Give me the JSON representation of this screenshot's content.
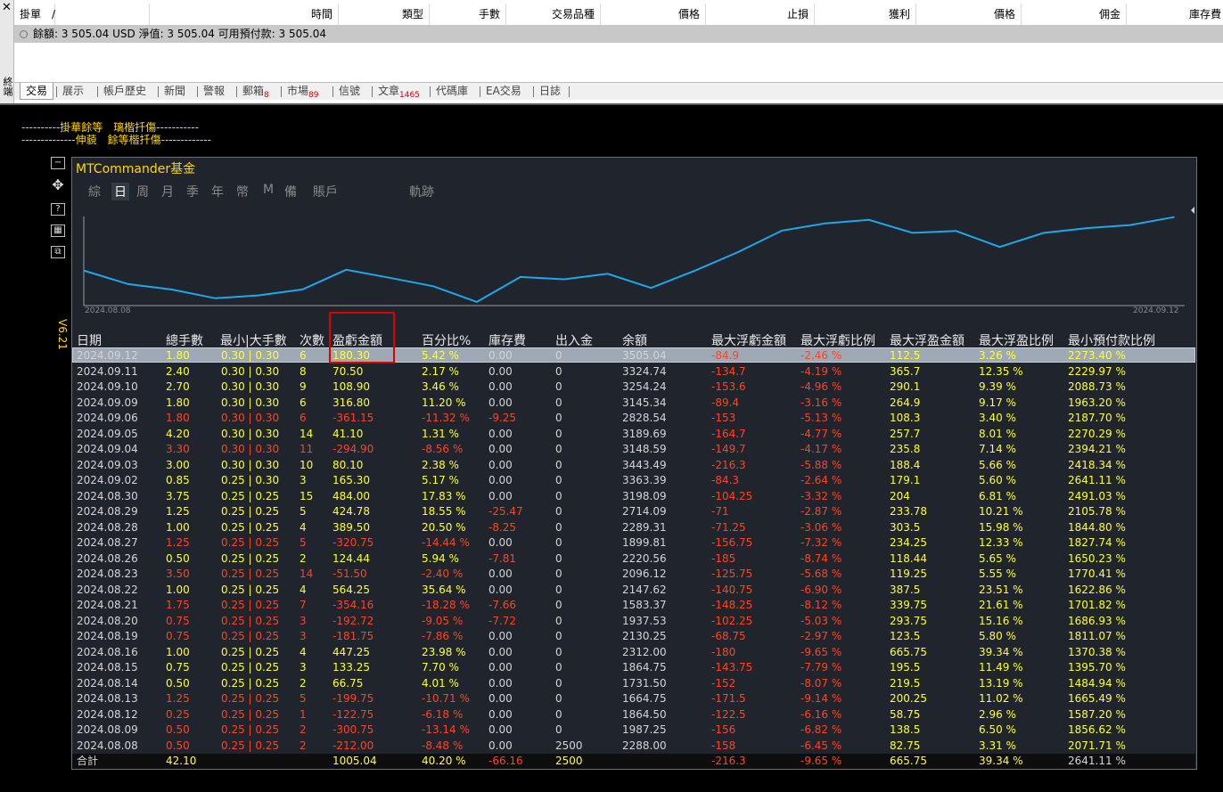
{
  "window": {
    "close_glyph": "✕",
    "side_label": "終端"
  },
  "header": {
    "columns": [
      "掛單",
      "/",
      "時間",
      "類型",
      "手數",
      "交易品種",
      "價格",
      "止損",
      "獲利",
      "價格",
      "佣金",
      "庫存費"
    ]
  },
  "balance_text": "餘額: 3 505.04 USD  淨值: 3 505.04  可用預付款: 3 505.04",
  "tabs": [
    {
      "label": "交易",
      "badge": ""
    },
    {
      "label": "展示",
      "badge": ""
    },
    {
      "label": "帳戶歷史",
      "badge": ""
    },
    {
      "label": "新聞",
      "badge": ""
    },
    {
      "label": "警報",
      "badge": ""
    },
    {
      "label": "郵箱",
      "badge": "8"
    },
    {
      "label": "市場",
      "badge": "89"
    },
    {
      "label": "信號",
      "badge": ""
    },
    {
      "label": "文章",
      "badge": "1465"
    },
    {
      "label": "代碼庫",
      "badge": ""
    },
    {
      "label": "EA交易",
      "badge": ""
    },
    {
      "label": "日誌",
      "badge": ""
    }
  ],
  "comments": [
    "----------掛華餘等　璃楷扦傷-----------",
    "--------------伸藐　餘等楷扦傷-------------"
  ],
  "version": "V6.21",
  "panel": {
    "title": "MTCommander基金",
    "menu": [
      "綜",
      "日",
      "周",
      "月",
      "季",
      "年",
      "幣",
      "M",
      "備",
      "賬戶",
      "軌跡"
    ],
    "active_menu": "日",
    "graph_start_label": "2024.08.08",
    "graph_end_label": "2024.09.12"
  },
  "chart_data": {
    "type": "line",
    "x": [
      "2024.08.08",
      "2024.08.09",
      "2024.08.12",
      "2024.08.13",
      "2024.08.14",
      "2024.08.15",
      "2024.08.16",
      "2024.08.19",
      "2024.08.20",
      "2024.08.21",
      "2024.08.22",
      "2024.08.23",
      "2024.08.26",
      "2024.08.27",
      "2024.08.28",
      "2024.08.29",
      "2024.08.30",
      "2024.09.02",
      "2024.09.03",
      "2024.09.04",
      "2024.09.05",
      "2024.09.06",
      "2024.09.09",
      "2024.09.10",
      "2024.09.11",
      "2024.09.12"
    ],
    "series": [
      {
        "values": [
          2288.0,
          1987.25,
          1864.5,
          1664.75,
          1731.5,
          1864.75,
          2312.0,
          2130.25,
          1937.53,
          1583.37,
          2147.62,
          2096.12,
          2220.56,
          1899.81,
          2289.31,
          2714.09,
          3198.09,
          3363.39,
          3443.49,
          3148.59,
          3189.69,
          2828.54,
          3145.34,
          3254.24,
          3324.74,
          3505.04
        ]
      }
    ],
    "color": "#1ea8ec",
    "ylim": [
      1500,
      3560
    ]
  },
  "table": {
    "headers": [
      "日期",
      "總手數",
      "最小|大手數",
      "次數",
      "盈虧金額",
      "百分比%",
      "庫存費",
      "出入金",
      "余額",
      "最大浮虧金額",
      "最大浮虧比例",
      "最大浮盈金額",
      "最大浮盈比例",
      "最小預付款比例"
    ],
    "rows": [
      [
        "2024.09.12",
        "1.80",
        "0.30 | 0.30",
        "6",
        "180.30",
        "5.42 %",
        "0.00",
        "0",
        "3505.04",
        "-84.9",
        "-2.46 %",
        "112.5",
        "3.26 %",
        "2273.40 %"
      ],
      [
        "2024.09.11",
        "2.40",
        "0.30 | 0.30",
        "8",
        "70.50",
        "2.17 %",
        "0.00",
        "0",
        "3324.74",
        "-134.7",
        "-4.19 %",
        "365.7",
        "12.35 %",
        "2229.97 %"
      ],
      [
        "2024.09.10",
        "2.70",
        "0.30 | 0.30",
        "9",
        "108.90",
        "3.46 %",
        "0.00",
        "0",
        "3254.24",
        "-153.6",
        "-4.96 %",
        "290.1",
        "9.39 %",
        "2088.73 %"
      ],
      [
        "2024.09.09",
        "1.80",
        "0.30 | 0.30",
        "6",
        "316.80",
        "11.20 %",
        "0.00",
        "0",
        "3145.34",
        "-89.4",
        "-3.16 %",
        "264.9",
        "9.17 %",
        "1963.20 %"
      ],
      [
        "2024.09.06",
        "1.80",
        "0.30 | 0.30",
        "6",
        "-361.15",
        "-11.32 %",
        "-9.25",
        "0",
        "2828.54",
        "-153",
        "-5.13 %",
        "108.3",
        "3.40 %",
        "2187.70 %"
      ],
      [
        "2024.09.05",
        "4.20",
        "0.30 | 0.30",
        "14",
        "41.10",
        "1.31 %",
        "0.00",
        "0",
        "3189.69",
        "-164.7",
        "-4.77 %",
        "257.7",
        "8.01 %",
        "2270.29 %"
      ],
      [
        "2024.09.04",
        "3.30",
        "0.30 | 0.30",
        "11",
        "-294.90",
        "-8.56 %",
        "0.00",
        "0",
        "3148.59",
        "-149.7",
        "-4.17 %",
        "235.8",
        "7.14 %",
        "2394.21 %"
      ],
      [
        "2024.09.03",
        "3.00",
        "0.30 | 0.30",
        "10",
        "80.10",
        "2.38 %",
        "0.00",
        "0",
        "3443.49",
        "-216.3",
        "-5.88 %",
        "188.4",
        "5.66 %",
        "2418.34 %"
      ],
      [
        "2024.09.02",
        "0.85",
        "0.25 | 0.30",
        "3",
        "165.30",
        "5.17 %",
        "0.00",
        "0",
        "3363.39",
        "-84.3",
        "-2.64 %",
        "179.1",
        "5.60 %",
        "2641.11 %"
      ],
      [
        "2024.08.30",
        "3.75",
        "0.25 | 0.25",
        "15",
        "484.00",
        "17.83 %",
        "0.00",
        "0",
        "3198.09",
        "-104.25",
        "-3.32 %",
        "204",
        "6.81 %",
        "2491.03 %"
      ],
      [
        "2024.08.29",
        "1.25",
        "0.25 | 0.25",
        "5",
        "424.78",
        "18.55 %",
        "-25.47",
        "0",
        "2714.09",
        "-71",
        "-2.87 %",
        "233.78",
        "10.21 %",
        "2105.78 %"
      ],
      [
        "2024.08.28",
        "1.00",
        "0.25 | 0.25",
        "4",
        "389.50",
        "20.50 %",
        "-8.25",
        "0",
        "2289.31",
        "-71.25",
        "-3.06 %",
        "303.5",
        "15.98 %",
        "1844.80 %"
      ],
      [
        "2024.08.27",
        "1.25",
        "0.25 | 0.25",
        "5",
        "-320.75",
        "-14.44 %",
        "0.00",
        "0",
        "1899.81",
        "-156.75",
        "-7.32 %",
        "234.25",
        "12.33 %",
        "1827.74 %"
      ],
      [
        "2024.08.26",
        "0.50",
        "0.25 | 0.25",
        "2",
        "124.44",
        "5.94 %",
        "-7.81",
        "0",
        "2220.56",
        "-185",
        "-8.74 %",
        "118.44",
        "5.65 %",
        "1650.23 %"
      ],
      [
        "2024.08.23",
        "3.50",
        "0.25 | 0.25",
        "14",
        "-51.50",
        "-2.40 %",
        "0.00",
        "0",
        "2096.12",
        "-125.75",
        "-5.68 %",
        "119.25",
        "5.55 %",
        "1770.41 %"
      ],
      [
        "2024.08.22",
        "1.00",
        "0.25 | 0.25",
        "4",
        "564.25",
        "35.64 %",
        "0.00",
        "0",
        "2147.62",
        "-140.75",
        "-6.90 %",
        "387.5",
        "23.51 %",
        "1622.86 %"
      ],
      [
        "2024.08.21",
        "1.75",
        "0.25 | 0.25",
        "7",
        "-354.16",
        "-18.28 %",
        "-7.66",
        "0",
        "1583.37",
        "-148.25",
        "-8.12 %",
        "339.75",
        "21.61 %",
        "1701.82 %"
      ],
      [
        "2024.08.20",
        "0.75",
        "0.25 | 0.25",
        "3",
        "-192.72",
        "-9.05 %",
        "-7.72",
        "0",
        "1937.53",
        "-102.25",
        "-5.03 %",
        "293.75",
        "15.16 %",
        "1686.93 %"
      ],
      [
        "2024.08.19",
        "0.75",
        "0.25 | 0.25",
        "3",
        "-181.75",
        "-7.86 %",
        "0.00",
        "0",
        "2130.25",
        "-68.75",
        "-2.97 %",
        "123.5",
        "5.80 %",
        "1811.07 %"
      ],
      [
        "2024.08.16",
        "1.00",
        "0.25 | 0.25",
        "4",
        "447.25",
        "23.98 %",
        "0.00",
        "0",
        "2312.00",
        "-180",
        "-9.65 %",
        "665.75",
        "39.34 %",
        "1370.38 %"
      ],
      [
        "2024.08.15",
        "0.75",
        "0.25 | 0.25",
        "3",
        "133.25",
        "7.70 %",
        "0.00",
        "0",
        "1864.75",
        "-143.75",
        "-7.79 %",
        "195.5",
        "11.49 %",
        "1395.70 %"
      ],
      [
        "2024.08.14",
        "0.50",
        "0.25 | 0.25",
        "2",
        "66.75",
        "4.01 %",
        "0.00",
        "0",
        "1731.50",
        "-152",
        "-8.07 %",
        "219.5",
        "13.19 %",
        "1484.94 %"
      ],
      [
        "2024.08.13",
        "1.25",
        "0.25 | 0.25",
        "5",
        "-199.75",
        "-10.71 %",
        "0.00",
        "0",
        "1664.75",
        "-171.5",
        "-9.14 %",
        "200.25",
        "11.02 %",
        "1665.49 %"
      ],
      [
        "2024.08.12",
        "0.25",
        "0.25 | 0.25",
        "1",
        "-122.75",
        "-6.18 %",
        "0.00",
        "0",
        "1864.50",
        "-122.5",
        "-6.16 %",
        "58.75",
        "2.96 %",
        "1587.20 %"
      ],
      [
        "2024.08.09",
        "0.50",
        "0.25 | 0.25",
        "2",
        "-300.75",
        "-13.14 %",
        "0.00",
        "0",
        "1987.25",
        "-156",
        "-6.82 %",
        "138.5",
        "6.50 %",
        "1856.62 %"
      ],
      [
        "2024.08.08",
        "0.50",
        "0.25 | 0.25",
        "2",
        "-212.00",
        "-8.48 %",
        "0.00",
        "2500",
        "2288.00",
        "-158",
        "-6.45 %",
        "82.75",
        "3.31 %",
        "2071.71 %"
      ]
    ],
    "totals": [
      "合計",
      "42.10",
      "",
      "",
      "1005.04",
      "40.20 %",
      "-66.16",
      "2500",
      "",
      "-216.3",
      "-9.65 %",
      "665.75",
      "39.34 %",
      "2641.11 %"
    ]
  },
  "colors": {
    "profit": "#ffff33",
    "loss": "#ff4422",
    "neutral": "#d4d4d4",
    "line": "#1ea8ec",
    "highlight_box": "#e00000"
  }
}
